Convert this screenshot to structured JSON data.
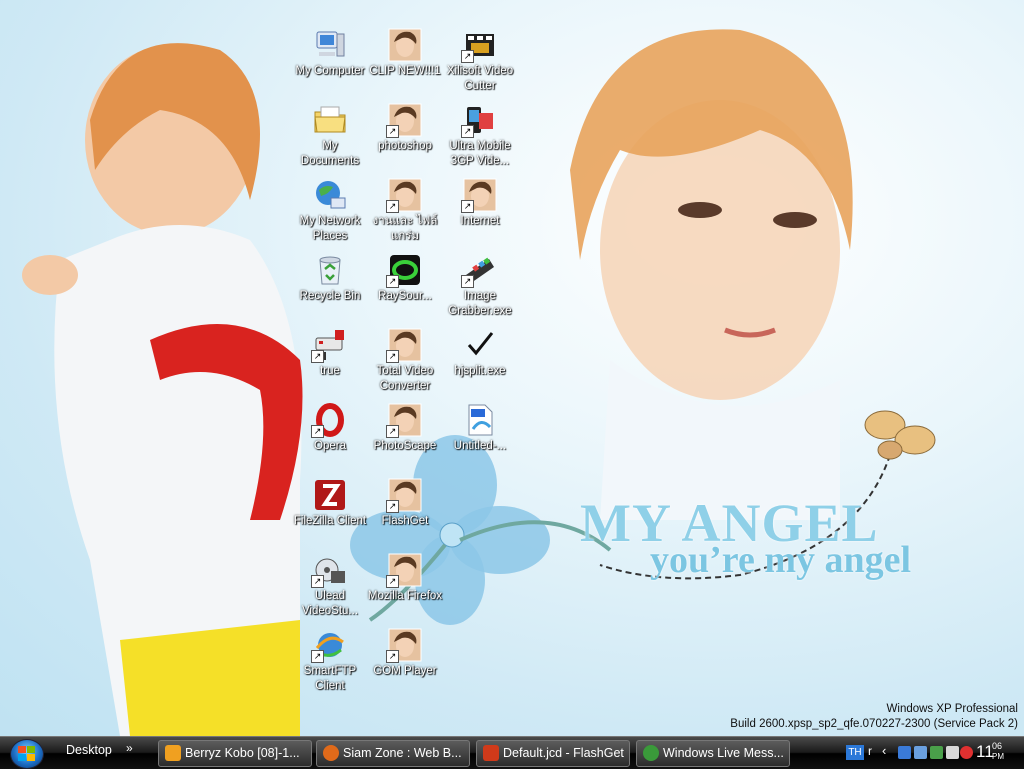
{
  "wallpaper": {
    "title": "MY ANGEL",
    "subtitle": "you’re my angel",
    "os_name": "Windows XP Professional",
    "os_build": "Build 2600.xpsp_sp2_qfe.070227-2300 (Service Pack 2)"
  },
  "desktop_icons": [
    {
      "label": "My Computer",
      "icon": "computer-icon"
    },
    {
      "label": "CLIP NEW!!!1",
      "icon": "photo-thumbnail-icon"
    },
    {
      "label": "Xilisoft Video Cutter",
      "icon": "video-cutter-icon"
    },
    {
      "label": "My Documents",
      "icon": "folder-icon"
    },
    {
      "label": "photoshop",
      "icon": "photo-thumbnail-icon"
    },
    {
      "label": "Ultra Mobile 3GP Vide...",
      "icon": "mobile-video-icon"
    },
    {
      "label": "My Network Places",
      "icon": "network-icon"
    },
    {
      "label": "งานและ ไฟล์แกร่ม",
      "icon": "photo-thumbnail-icon"
    },
    {
      "label": "Internet",
      "icon": "photo-thumbnail-icon"
    },
    {
      "label": "Recycle Bin",
      "icon": "recycle-bin-icon"
    },
    {
      "label": "RaySour...",
      "icon": "raysource-icon"
    },
    {
      "label": "Image Grabber.exe",
      "icon": "film-strip-icon"
    },
    {
      "label": "true",
      "icon": "network-device-icon"
    },
    {
      "label": "Total Video Converter",
      "icon": "photo-thumbnail-icon"
    },
    {
      "label": "hjsplit.exe",
      "icon": "checkmark-icon"
    },
    {
      "label": "Opera",
      "icon": "opera-icon"
    },
    {
      "label": "PhotoScape",
      "icon": "photo-thumbnail-icon"
    },
    {
      "label": "Untitled-...",
      "icon": "psd-file-icon"
    },
    {
      "label": "FileZilla Client",
      "icon": "filezilla-icon"
    },
    {
      "label": "FlashGet",
      "icon": "photo-thumbnail-icon"
    },
    {
      "label": "Ulead VideoStu...",
      "icon": "ulead-icon"
    },
    {
      "label": "Mozilla Firefox",
      "icon": "photo-thumbnail-icon"
    },
    {
      "label": "SmartFTP Client",
      "icon": "smartftp-icon"
    },
    {
      "label": "GOM Player",
      "icon": "photo-thumbnail-icon"
    }
  ],
  "taskbar": {
    "toolbar_label": "Desktop",
    "toolbar_chevron": "»",
    "tasks": [
      {
        "label": "Berryz Kobo [08]-1...",
        "icon": "aimp-icon",
        "color": "#f0a020"
      },
      {
        "label": "Siam Zone : Web B...",
        "icon": "firefox-icon",
        "color": "#e06a1a"
      },
      {
        "label": "Default.jcd - FlashGet",
        "icon": "flashget-icon",
        "color": "#d03a1a"
      },
      {
        "label": "Windows Live Mess...",
        "icon": "messenger-icon",
        "color": "#3a9a3a"
      }
    ],
    "tray": {
      "language": "TH",
      "clock_hour": "11",
      "clock_minutes": "06",
      "clock_ampm": "PM"
    }
  }
}
